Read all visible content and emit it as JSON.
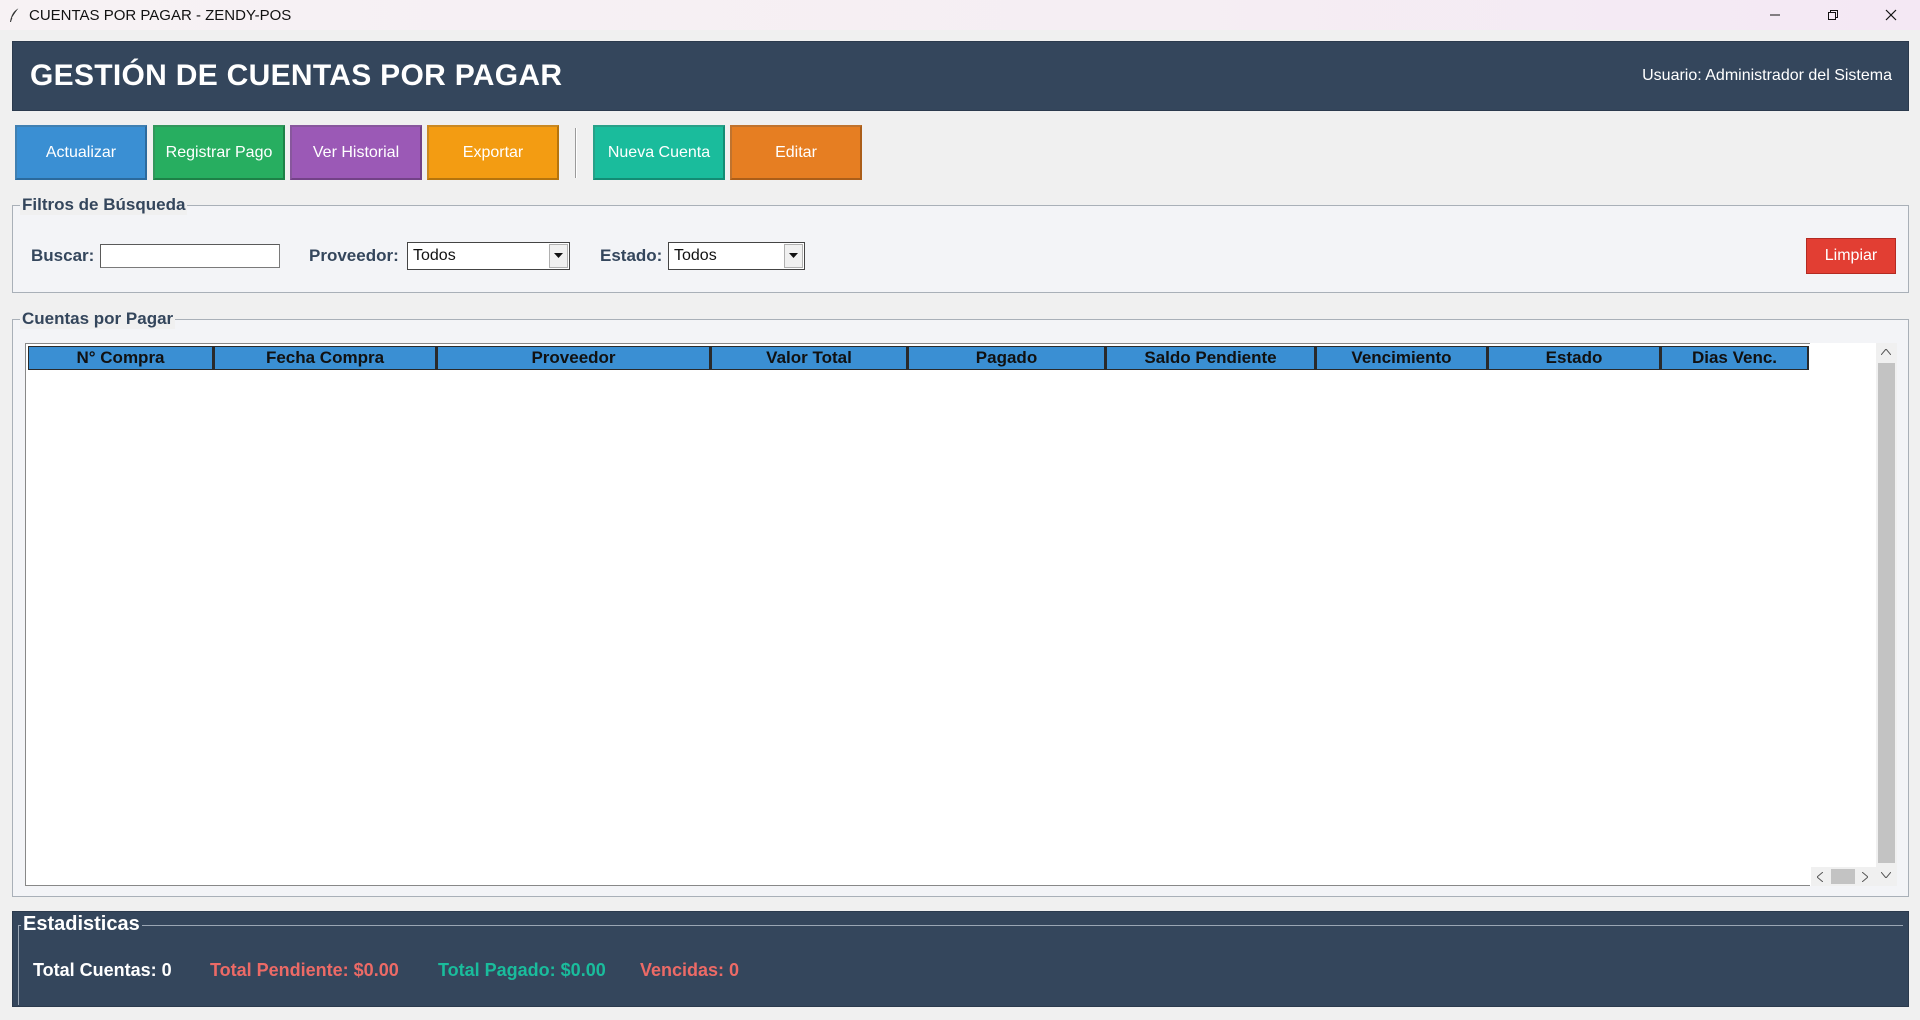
{
  "window": {
    "title": "CUENTAS POR PAGAR - ZENDY-POS",
    "controls": [
      "minimize-icon",
      "restore-icon",
      "close-icon"
    ]
  },
  "header": {
    "title": "GESTIÓN DE CUENTAS POR PAGAR",
    "user": "Usuario: Administrador del Sistema"
  },
  "toolbar": {
    "actualizar": "Actualizar",
    "registrar_pago": "Registrar Pago",
    "ver_historial": "Ver Historial",
    "exportar": "Exportar",
    "nueva_cuenta": "Nueva Cuenta",
    "editar": "Editar"
  },
  "colors": {
    "header_bg": "#34465c",
    "actualizar": "#3a8fd3",
    "registrar_pago": "#27ae60",
    "ver_historial": "#9b59b6",
    "exportar": "#f39c12",
    "nueva_cuenta": "#1abc9c",
    "editar": "#e67e22",
    "limpiar": "#e23e33",
    "table_header": "#3a8fd3",
    "stat_total_cuentas": "#ffffff",
    "stat_pendiente": "#ec6a66",
    "stat_pagado": "#1abc9c",
    "stat_vencidas": "#ec6a66"
  },
  "filters": {
    "legend": "Filtros de Búsqueda",
    "buscar_label": "Buscar:",
    "buscar_value": "",
    "proveedor_label": "Proveedor:",
    "proveedor_value": "Todos",
    "estado_label": "Estado:",
    "estado_value": "Todos",
    "limpiar": "Limpiar"
  },
  "table": {
    "legend": "Cuentas por Pagar",
    "columns": [
      "N° Compra",
      "Fecha Compra",
      "Proveedor",
      "Valor Total",
      "Pagado",
      "Saldo Pendiente",
      "Vencimiento",
      "Estado",
      "Dias Venc."
    ],
    "rows": []
  },
  "stats": {
    "legend": "Estadisticas",
    "total_cuentas": "Total Cuentas: 0",
    "total_pendiente": "Total Pendiente: $0.00",
    "total_pagado": "Total Pagado: $0.00",
    "vencidas": "Vencidas: 0"
  }
}
